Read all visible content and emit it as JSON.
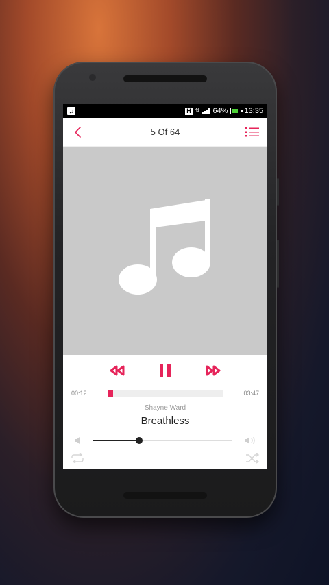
{
  "statusbar": {
    "notif_icon": "music-note-icon",
    "network": "H",
    "battery": "64%",
    "time": "13:35"
  },
  "header": {
    "title": "5 Of 64",
    "back_icon": "chevron-left-icon",
    "playlist_icon": "playlist-icon"
  },
  "artwork": {
    "icon": "music-note-icon"
  },
  "player": {
    "elapsed": "00:12",
    "duration": "03:47",
    "progress_fraction": 0.053,
    "artist": "Shayne Ward",
    "song": "Breathless",
    "volume_fraction": 0.33
  },
  "colors": {
    "accent": "#e6245a",
    "artwork_bg": "#c9c9c9"
  }
}
